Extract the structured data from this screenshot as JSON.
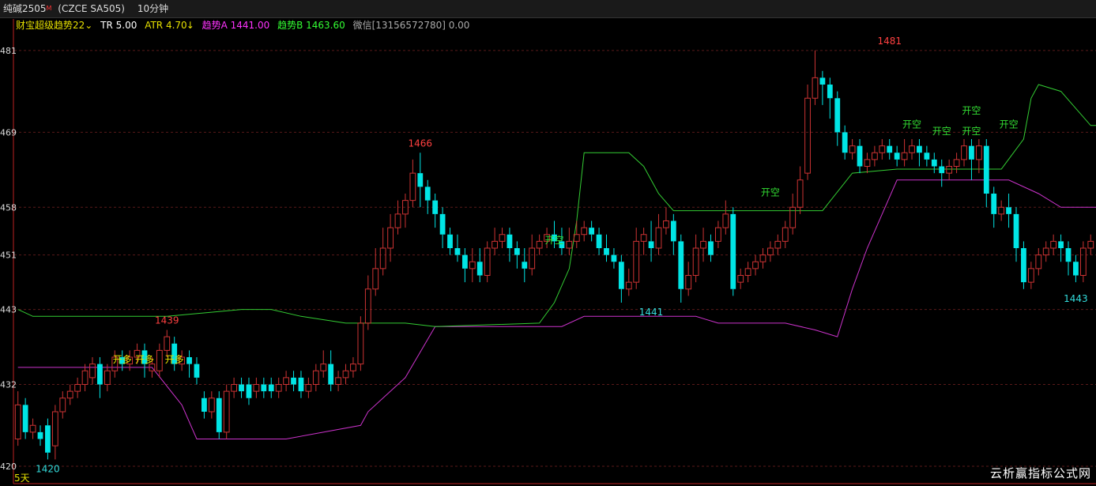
{
  "header": {
    "symbol": "纯碱2505",
    "marker": "M",
    "code": "(CZCE SA505)",
    "period": "10分钟"
  },
  "indicator": {
    "name": "财宝超级趋势22",
    "tr": "TR 5.00",
    "atr": "ATR 4.70",
    "trendA": "趋势A 1441.00",
    "trendB": "趋势B 1463.60",
    "wechat": "微信[13156572780] 0.00",
    "colors": {
      "name": "#e6e000",
      "tr": "#ffffff",
      "atr": "#e6e000",
      "trendA": "#ff33ff",
      "trendB": "#33ff33",
      "wechat": "#aaaaaa"
    }
  },
  "footer": {
    "days": "5天",
    "watermark": "云析赢指标公式网"
  },
  "chart_data": {
    "type": "candlestick",
    "ylim": [
      1420,
      1484
    ],
    "y_ticks": [
      {
        "value": 1481,
        "label": "481"
      },
      {
        "value": 1469,
        "label": "469"
      },
      {
        "value": 1458,
        "label": "458"
      },
      {
        "value": 1451,
        "label": "451"
      },
      {
        "value": 1443,
        "label": "443"
      },
      {
        "value": 1432,
        "label": "432"
      },
      {
        "value": 1420,
        "label": "420"
      }
    ],
    "colors": {
      "up": "#cc3333",
      "down": "#00e5e5",
      "trendA": "#cc33cc",
      "trendB": "#33cc33",
      "grid": "#5a1a1a",
      "axis": "#bb2222"
    },
    "candles": [
      [
        1424,
        1429,
        1423,
        1431
      ],
      [
        1429,
        1425,
        1424,
        1430
      ],
      [
        1425,
        1426,
        1424,
        1427
      ],
      [
        1425,
        1424,
        1423,
        1426
      ],
      [
        1426,
        1422,
        1421,
        1427
      ],
      [
        1423,
        1428,
        1421,
        1429
      ],
      [
        1428,
        1430,
        1427,
        1431
      ],
      [
        1430,
        1431,
        1429,
        1432
      ],
      [
        1431,
        1432,
        1430,
        1433
      ],
      [
        1432,
        1434,
        1431,
        1435
      ],
      [
        1433,
        1435,
        1432,
        1436
      ],
      [
        1435,
        1432,
        1430,
        1436
      ],
      [
        1432,
        1434,
        1431,
        1435
      ],
      [
        1434,
        1436,
        1433,
        1437
      ],
      [
        1436,
        1435,
        1434,
        1437
      ],
      [
        1435,
        1436,
        1434,
        1437
      ],
      [
        1436,
        1437,
        1435,
        1438
      ],
      [
        1437,
        1435,
        1433,
        1438
      ],
      [
        1434,
        1435,
        1433,
        1436
      ],
      [
        1434,
        1437,
        1433,
        1438
      ],
      [
        1437,
        1439,
        1436,
        1440
      ],
      [
        1438,
        1435,
        1434,
        1439
      ],
      [
        1435,
        1436,
        1434,
        1437
      ],
      [
        1436,
        1435,
        1433,
        1437
      ],
      [
        1435,
        1433,
        1432,
        1436
      ],
      [
        1430,
        1428,
        1427,
        1431
      ],
      [
        1428,
        1430,
        1427,
        1431
      ],
      [
        1430,
        1425,
        1424,
        1431
      ],
      [
        1425,
        1431,
        1424,
        1432
      ],
      [
        1431,
        1432,
        1430,
        1433
      ],
      [
        1432,
        1431,
        1430,
        1433
      ],
      [
        1432,
        1430,
        1429,
        1433
      ],
      [
        1431,
        1432,
        1430,
        1433
      ],
      [
        1432,
        1431,
        1430,
        1433
      ],
      [
        1432,
        1431,
        1430,
        1433
      ],
      [
        1431,
        1432,
        1430,
        1433
      ],
      [
        1432,
        1433,
        1431,
        1434
      ],
      [
        1433,
        1432,
        1431,
        1434
      ],
      [
        1433,
        1431,
        1430,
        1434
      ],
      [
        1431,
        1432,
        1430,
        1433
      ],
      [
        1432,
        1434,
        1431,
        1435
      ],
      [
        1434,
        1435,
        1433,
        1437
      ],
      [
        1435,
        1432,
        1431,
        1437
      ],
      [
        1432,
        1433,
        1431,
        1434
      ],
      [
        1433,
        1434,
        1432,
        1435
      ],
      [
        1434,
        1435,
        1433,
        1436
      ],
      [
        1435,
        1441,
        1434,
        1442
      ],
      [
        1441,
        1446,
        1440,
        1448
      ],
      [
        1446,
        1449,
        1445,
        1452
      ],
      [
        1449,
        1452,
        1448,
        1455
      ],
      [
        1452,
        1455,
        1450,
        1457
      ],
      [
        1455,
        1457,
        1454,
        1459
      ],
      [
        1457,
        1459,
        1455,
        1460
      ],
      [
        1459,
        1463,
        1458,
        1465
      ],
      [
        1463,
        1461,
        1458,
        1466
      ],
      [
        1461,
        1459,
        1457,
        1462
      ],
      [
        1459,
        1457,
        1455,
        1460
      ],
      [
        1457,
        1454,
        1452,
        1458
      ],
      [
        1454,
        1452,
        1451,
        1455
      ],
      [
        1452,
        1451,
        1450,
        1454
      ],
      [
        1451,
        1449,
        1447,
        1452
      ],
      [
        1449,
        1450,
        1447,
        1452
      ],
      [
        1450,
        1448,
        1447,
        1452
      ],
      [
        1448,
        1452,
        1447,
        1453
      ],
      [
        1452,
        1453,
        1451,
        1455
      ],
      [
        1453,
        1454,
        1452,
        1455
      ],
      [
        1454,
        1452,
        1450,
        1455
      ],
      [
        1452,
        1451,
        1449,
        1453
      ],
      [
        1450,
        1449,
        1447,
        1452
      ],
      [
        1449,
        1452,
        1448,
        1454
      ],
      [
        1452,
        1453,
        1451,
        1454
      ],
      [
        1453,
        1454,
        1452,
        1455
      ],
      [
        1454,
        1453,
        1452,
        1456
      ],
      [
        1453,
        1452,
        1451,
        1455
      ],
      [
        1452,
        1453,
        1451,
        1455
      ],
      [
        1453,
        1454,
        1452,
        1456
      ],
      [
        1454,
        1455,
        1453,
        1456
      ],
      [
        1455,
        1454,
        1453,
        1456
      ],
      [
        1454,
        1452,
        1451,
        1455
      ],
      [
        1452,
        1451,
        1450,
        1454
      ],
      [
        1451,
        1450,
        1449,
        1452
      ],
      [
        1450,
        1446,
        1444,
        1451
      ],
      [
        1446,
        1447,
        1445,
        1449
      ],
      [
        1447,
        1453,
        1446,
        1455
      ],
      [
        1453,
        1454,
        1451,
        1455
      ],
      [
        1453,
        1452,
        1450,
        1456
      ],
      [
        1452,
        1455,
        1451,
        1457
      ],
      [
        1455,
        1456,
        1454,
        1458
      ],
      [
        1456,
        1453,
        1451,
        1457
      ],
      [
        1453,
        1446,
        1444,
        1454
      ],
      [
        1446,
        1448,
        1445,
        1450
      ],
      [
        1448,
        1452,
        1447,
        1454
      ],
      [
        1452,
        1453,
        1450,
        1455
      ],
      [
        1453,
        1451,
        1450,
        1454
      ],
      [
        1453,
        1455,
        1452,
        1456
      ],
      [
        1455,
        1457,
        1454,
        1459
      ],
      [
        1457,
        1446,
        1445,
        1458
      ],
      [
        1447,
        1448,
        1446,
        1449
      ],
      [
        1448,
        1449,
        1447,
        1450
      ],
      [
        1449,
        1450,
        1448,
        1451
      ],
      [
        1450,
        1451,
        1449,
        1452
      ],
      [
        1451,
        1452,
        1450,
        1453
      ],
      [
        1452,
        1453,
        1451,
        1454
      ],
      [
        1453,
        1455,
        1452,
        1456
      ],
      [
        1455,
        1458,
        1454,
        1460
      ],
      [
        1458,
        1462,
        1457,
        1464
      ],
      [
        1463,
        1474,
        1462,
        1476
      ],
      [
        1474,
        1477,
        1473,
        1481
      ],
      [
        1477,
        1476,
        1473,
        1478
      ],
      [
        1476,
        1474,
        1471,
        1477
      ],
      [
        1474,
        1469,
        1467,
        1475
      ],
      [
        1469,
        1466,
        1465,
        1470
      ],
      [
        1466,
        1467,
        1465,
        1468
      ],
      [
        1467,
        1464,
        1463,
        1468
      ],
      [
        1464,
        1465,
        1463,
        1466
      ],
      [
        1465,
        1466,
        1464,
        1467
      ],
      [
        1466,
        1467,
        1465,
        1468
      ],
      [
        1467,
        1466,
        1465,
        1468
      ],
      [
        1466,
        1465,
        1464,
        1467
      ],
      [
        1465,
        1466,
        1464,
        1468
      ],
      [
        1466,
        1467,
        1465,
        1468
      ],
      [
        1467,
        1466,
        1464,
        1468
      ],
      [
        1466,
        1465,
        1464,
        1467
      ],
      [
        1465,
        1464,
        1463,
        1466
      ],
      [
        1464,
        1463,
        1461,
        1465
      ],
      [
        1463,
        1464,
        1462,
        1465
      ],
      [
        1464,
        1465,
        1463,
        1466
      ],
      [
        1465,
        1467,
        1464,
        1468
      ],
      [
        1467,
        1465,
        1462,
        1468
      ],
      [
        1465,
        1467,
        1463,
        1468
      ],
      [
        1467,
        1460,
        1458,
        1468
      ],
      [
        1460,
        1457,
        1455,
        1461
      ],
      [
        1457,
        1458,
        1456,
        1459
      ],
      [
        1458,
        1457,
        1455,
        1460
      ],
      [
        1457,
        1452,
        1450,
        1458
      ],
      [
        1452,
        1447,
        1446,
        1453
      ],
      [
        1447,
        1449,
        1446,
        1450
      ],
      [
        1449,
        1451,
        1448,
        1452
      ],
      [
        1451,
        1452,
        1450,
        1453
      ],
      [
        1452,
        1453,
        1451,
        1454
      ],
      [
        1453,
        1452,
        1450,
        1454
      ],
      [
        1452,
        1450,
        1448,
        1453
      ],
      [
        1450,
        1448,
        1447,
        1451
      ],
      [
        1448,
        1452,
        1447,
        1453
      ],
      [
        1452,
        1453,
        1451,
        1454
      ]
    ],
    "trendA": [
      [
        0,
        1434.5
      ],
      [
        18,
        1434.5
      ],
      [
        22,
        1429
      ],
      [
        24,
        1424
      ],
      [
        36,
        1424
      ],
      [
        46,
        1426
      ],
      [
        47,
        1428
      ],
      [
        52,
        1433
      ],
      [
        56,
        1440.5
      ],
      [
        73,
        1440.5
      ],
      [
        76,
        1442
      ],
      [
        84,
        1442
      ],
      [
        91,
        1442
      ],
      [
        94,
        1441
      ],
      [
        101,
        1441
      ],
      [
        103,
        1441
      ],
      [
        107,
        1440
      ],
      [
        110,
        1439
      ],
      [
        112,
        1446
      ],
      [
        114,
        1452
      ],
      [
        118,
        1462
      ],
      [
        122,
        1462
      ],
      [
        133,
        1462
      ],
      [
        137,
        1460
      ],
      [
        140,
        1458
      ],
      [
        152,
        1458
      ]
    ],
    "trendB": [
      [
        0,
        1443
      ],
      [
        2,
        1442
      ],
      [
        10,
        1442
      ],
      [
        20,
        1442
      ],
      [
        30,
        1443
      ],
      [
        34,
        1443
      ],
      [
        38,
        1442
      ],
      [
        44,
        1441
      ],
      [
        52,
        1441
      ],
      [
        56,
        1440.5
      ],
      [
        70,
        1441
      ],
      [
        72,
        1444
      ],
      [
        74,
        1449
      ],
      [
        75,
        1456
      ],
      [
        76,
        1466
      ],
      [
        82,
        1466
      ],
      [
        84,
        1464
      ],
      [
        86,
        1460
      ],
      [
        88,
        1457.5
      ],
      [
        100,
        1457.5
      ],
      [
        108,
        1457.5
      ],
      [
        112,
        1463
      ],
      [
        118,
        1463.6
      ],
      [
        132,
        1463.6
      ],
      [
        135,
        1468
      ],
      [
        136,
        1474
      ],
      [
        137,
        1476
      ],
      [
        140,
        1475
      ],
      [
        144,
        1470
      ],
      [
        150,
        1470
      ],
      [
        152,
        1468
      ]
    ],
    "annotations": [
      {
        "type": "value",
        "text": "1466",
        "i": 54,
        "y": 1466,
        "pos": "above",
        "color": "#ff4040"
      },
      {
        "type": "value",
        "text": "1439",
        "i": 20,
        "y": 1440,
        "pos": "above",
        "color": "#ff4040"
      },
      {
        "type": "value",
        "text": "1481",
        "i": 117,
        "y": 1481,
        "pos": "above",
        "color": "#ff4040"
      },
      {
        "type": "value",
        "text": "1441",
        "i": 85,
        "y": 1444,
        "pos": "below",
        "color": "#33dddd"
      },
      {
        "type": "value",
        "text": "1443",
        "i": 142,
        "y": 1446,
        "pos": "below",
        "color": "#33dddd"
      },
      {
        "type": "value",
        "text": "1420",
        "i": 4,
        "y": 1421,
        "pos": "below",
        "color": "#33dddd"
      },
      {
        "type": "signal",
        "text": "开多",
        "i": 14,
        "y": 1434.5,
        "color": "#e6e000"
      },
      {
        "type": "signal",
        "text": "开多",
        "i": 17,
        "y": 1434.5,
        "color": "#e6e000"
      },
      {
        "type": "signal",
        "text": "开多",
        "i": 21,
        "y": 1434.5,
        "color": "#e6e000"
      },
      {
        "type": "signal",
        "text": "开空",
        "i": 72,
        "y": 1452,
        "color": "#33dd33"
      },
      {
        "type": "signal",
        "text": "开空",
        "i": 101,
        "y": 1459,
        "color": "#33dd33"
      },
      {
        "type": "signal",
        "text": "开空",
        "i": 120,
        "y": 1469,
        "color": "#33dd33"
      },
      {
        "type": "signal",
        "text": "开空",
        "i": 124,
        "y": 1468,
        "color": "#33dd33"
      },
      {
        "type": "signal",
        "text": "开空",
        "i": 128,
        "y": 1468,
        "color": "#33dd33"
      },
      {
        "type": "signal",
        "text": "开空",
        "i": 128,
        "y": 1471,
        "color": "#33dd33"
      },
      {
        "type": "signal",
        "text": "开空",
        "i": 133,
        "y": 1469,
        "color": "#33dd33"
      }
    ]
  }
}
